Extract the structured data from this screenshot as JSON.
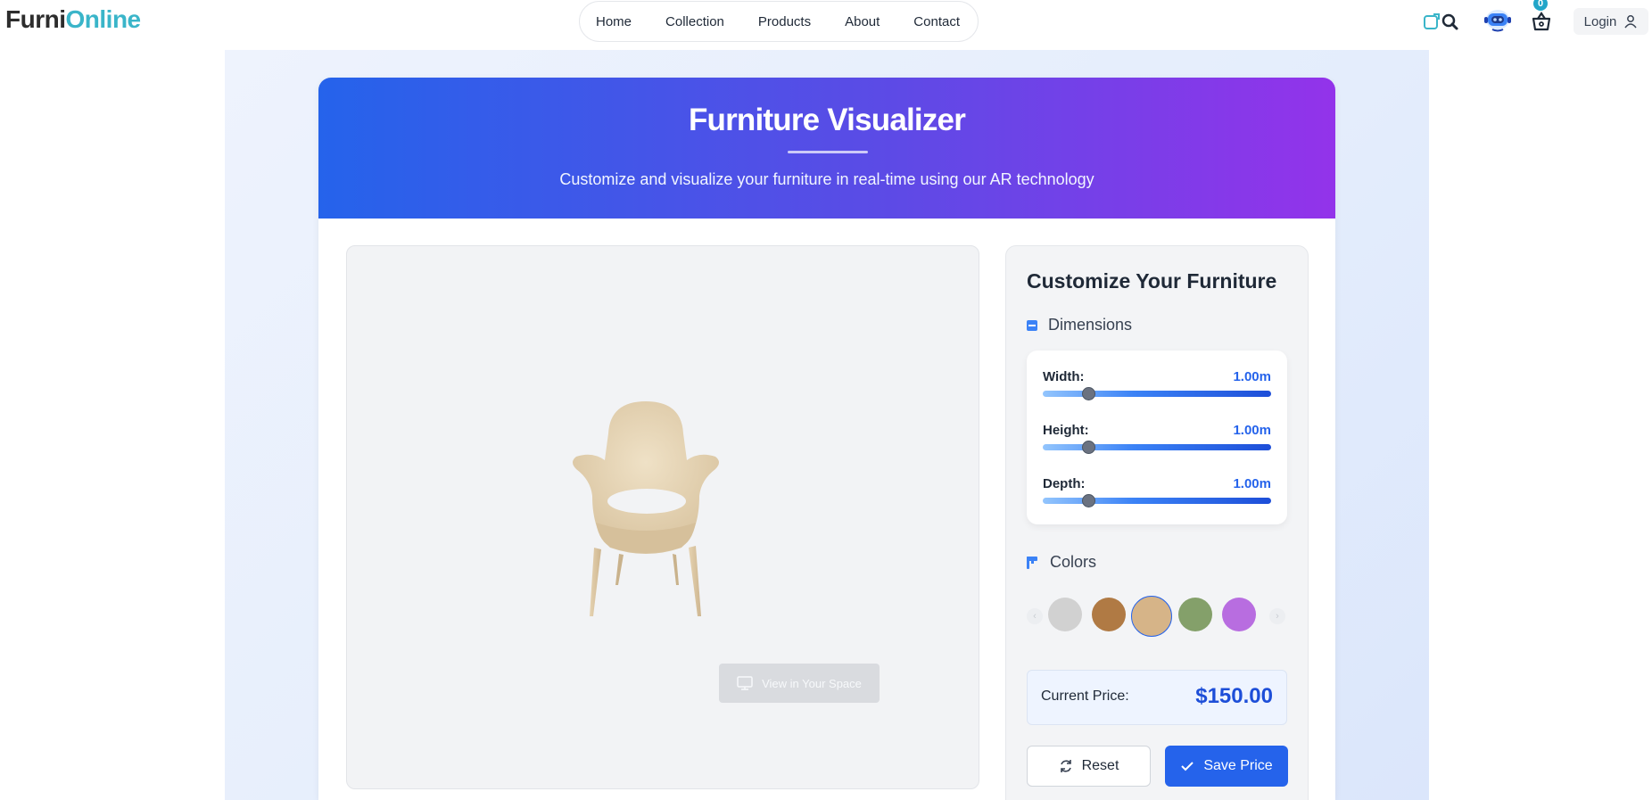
{
  "header": {
    "logo_part1": "Furni",
    "logo_part2": "Online",
    "nav": [
      "Home",
      "Collection",
      "Products",
      "About",
      "Contact"
    ],
    "cart_count": "0",
    "login_label": "Login"
  },
  "hero": {
    "title": "Furniture Visualizer",
    "subtitle": "Customize and visualize your furniture in real-time using our AR technology"
  },
  "viewer": {
    "ar_button_label": "View in Your Space"
  },
  "panel": {
    "title": "Customize Your Furniture",
    "dimensions_heading": "Dimensions",
    "dimensions": [
      {
        "label": "Width:",
        "value": "1.00m",
        "slider_fraction": 0.2
      },
      {
        "label": "Height:",
        "value": "1.00m",
        "slider_fraction": 0.2
      },
      {
        "label": "Depth:",
        "value": "1.00m",
        "slider_fraction": 0.2
      }
    ],
    "colors_heading": "Colors",
    "colors": [
      "#d1d1d1",
      "#b07a44",
      "#d6b488",
      "#84a06a",
      "#b86de0"
    ],
    "selected_color": "#d6b488",
    "price_label": "Current Price:",
    "price_value": "$150.00",
    "reset_label": "Reset",
    "save_label": "Save Price"
  },
  "accent_colors": {
    "primary": "#2563eb",
    "brand_teal": "#3ab5c9",
    "hero_gradient_start": "#2563eb",
    "hero_gradient_end": "#9333ea"
  }
}
